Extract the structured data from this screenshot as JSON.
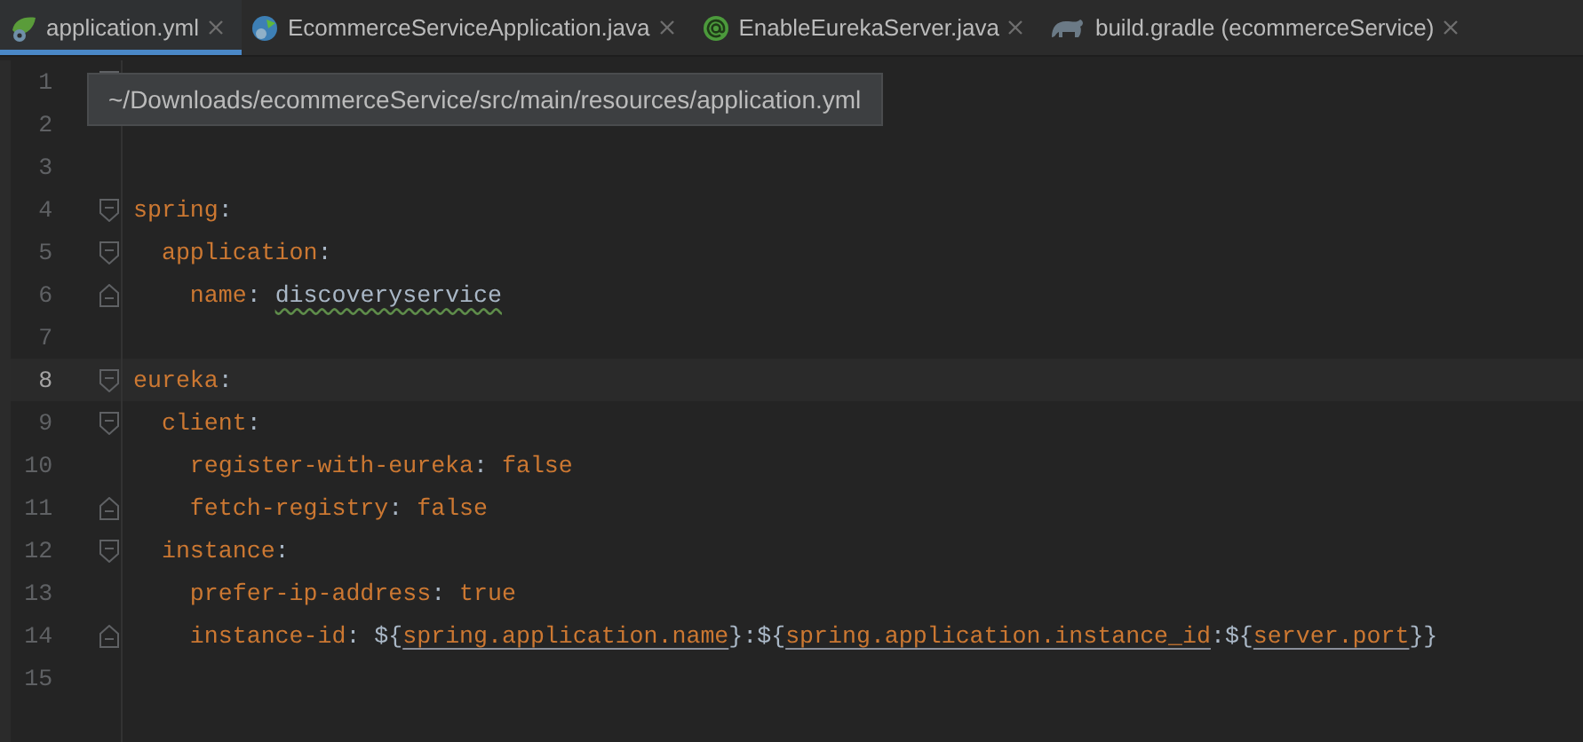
{
  "tabs": [
    {
      "label": "application.yml",
      "kind": "spring-boot",
      "selected": true
    },
    {
      "label": "EcommerceServiceApplication.java",
      "kind": "spring-app",
      "selected": false
    },
    {
      "label": "EnableEurekaServer.java",
      "kind": "annotation",
      "selected": false
    },
    {
      "label": "build.gradle (ecommerceService)",
      "kind": "gradle",
      "selected": false
    }
  ],
  "tooltip": "~/Downloads/ecommerceService/src/main/resources/application.yml",
  "lines": [
    {
      "number": "1",
      "kind": "opener",
      "current": false
    },
    {
      "number": "2",
      "kind": "plain",
      "current": false
    },
    {
      "number": "3",
      "kind": "plain",
      "current": false
    },
    {
      "number": "4",
      "kind": "opener",
      "current": false,
      "tokens": [
        {
          "kind": "key",
          "text": "spring"
        },
        {
          "kind": "punct",
          "text": ":"
        }
      ]
    },
    {
      "number": "5",
      "kind": "opener",
      "current": false,
      "tokens": [
        {
          "kind": "key",
          "text": "  application"
        },
        {
          "kind": "punct",
          "text": ":"
        }
      ]
    },
    {
      "number": "6",
      "kind": "closer",
      "current": false,
      "tokens": [
        {
          "kind": "key",
          "text": "    name"
        },
        {
          "kind": "punct",
          "text": ": "
        },
        {
          "kind": "typo",
          "text": "discoveryservice"
        }
      ]
    },
    {
      "number": "7",
      "kind": "plain",
      "current": false
    },
    {
      "number": "8",
      "kind": "opener",
      "current": true,
      "tokens": [
        {
          "kind": "key",
          "text": "eureka"
        },
        {
          "kind": "punct",
          "text": ":"
        }
      ]
    },
    {
      "number": "9",
      "kind": "opener",
      "current": false,
      "tokens": [
        {
          "kind": "key",
          "text": "  client"
        },
        {
          "kind": "punct",
          "text": ":"
        }
      ]
    },
    {
      "number": "10",
      "kind": "plain",
      "current": false,
      "tokens": [
        {
          "kind": "key",
          "text": "    register-with-eureka"
        },
        {
          "kind": "punct",
          "text": ": "
        },
        {
          "kind": "value",
          "text": "false"
        }
      ]
    },
    {
      "number": "11",
      "kind": "closer",
      "current": false,
      "tokens": [
        {
          "kind": "key",
          "text": "    fetch-registry"
        },
        {
          "kind": "punct",
          "text": ": "
        },
        {
          "kind": "value",
          "text": "false"
        }
      ]
    },
    {
      "number": "12",
      "kind": "opener",
      "current": false,
      "tokens": [
        {
          "kind": "key",
          "text": "  instance"
        },
        {
          "kind": "punct",
          "text": ":"
        }
      ]
    },
    {
      "number": "13",
      "kind": "plain",
      "current": false,
      "tokens": [
        {
          "kind": "key",
          "text": "    prefer-ip-address"
        },
        {
          "kind": "punct",
          "text": ": "
        },
        {
          "kind": "value",
          "text": "true"
        }
      ]
    },
    {
      "number": "14",
      "kind": "closer",
      "current": false,
      "tokens": [
        {
          "kind": "key",
          "text": "    instance-id"
        },
        {
          "kind": "punct",
          "text": ": ${"
        },
        {
          "kind": "ref",
          "text": "spring.application.name"
        },
        {
          "kind": "punct",
          "text": "}:${"
        },
        {
          "kind": "ref",
          "text": "spring.application.instance_id"
        },
        {
          "kind": "punct",
          "text": ":${"
        },
        {
          "kind": "ref",
          "text": "server.port"
        },
        {
          "kind": "punct",
          "text": "}}"
        }
      ]
    },
    {
      "number": "15",
      "kind": "plain",
      "current": false
    }
  ]
}
